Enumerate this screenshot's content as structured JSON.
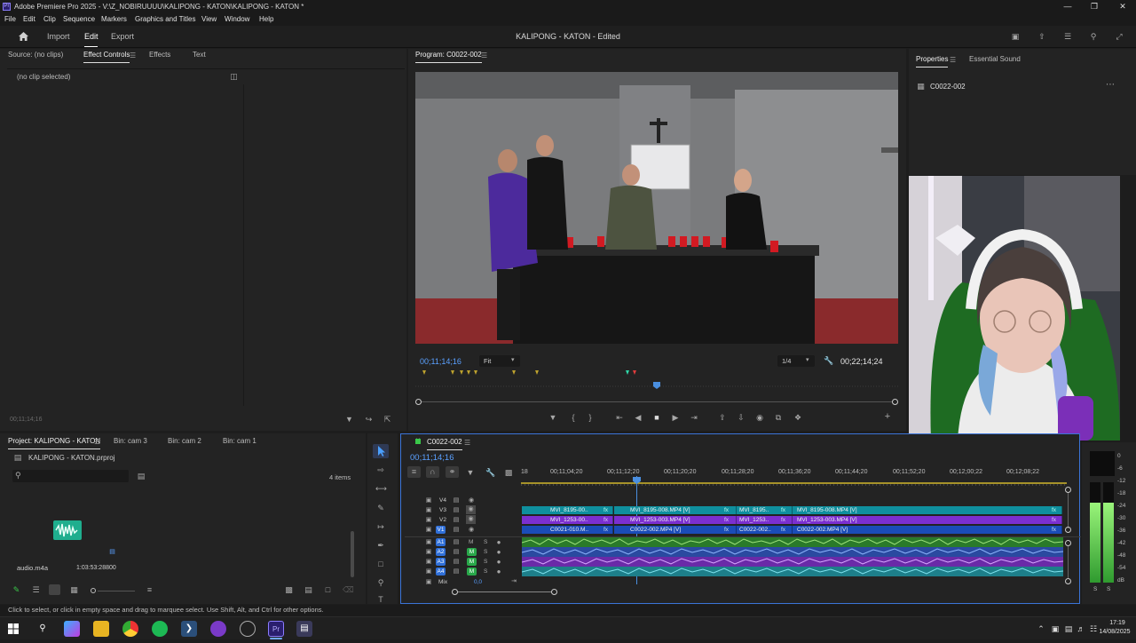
{
  "titlebar": {
    "title": "Adobe Premiere Pro 2025 - V:\\Z_NOBIRUUUU\\KALIPONG - KATON\\KALIPONG - KATON *",
    "logo": "Pr"
  },
  "menu": [
    "File",
    "Edit",
    "Clip",
    "Sequence",
    "Markers",
    "Graphics and Titles",
    "View",
    "Window",
    "Help"
  ],
  "workspace": {
    "tabs": [
      "Import",
      "Edit",
      "Export"
    ],
    "active": "Edit",
    "doc_title": "KALIPONG - KATON - Edited"
  },
  "source_panel": {
    "tabs": [
      "Source: (no clips)",
      "Effect Controls",
      "Effects",
      "Text"
    ],
    "active": "Effect Controls",
    "empty_msg": "(no clip selected)",
    "timecode": "00;11;14;16"
  },
  "program": {
    "title": "Program: C0022-002",
    "timecode": "00;11;14;16",
    "fit": "Fit",
    "quality": "1/4",
    "duration": "00;22;14;24"
  },
  "properties": {
    "tabs": [
      "Properties",
      "Essential Sound"
    ],
    "active": "Properties",
    "item": "C0022-002"
  },
  "project": {
    "tabs": [
      "Project: KALIPONG - KATON",
      "Bin: cam 3",
      "Bin: cam 2",
      "Bin: cam 1"
    ],
    "active": "Project: KALIPONG - KATON",
    "file": "KALIPONG - KATON.prproj",
    "items_count": "4 items",
    "asset_name": "audio.m4a",
    "asset_duration": "1:03:53:28800"
  },
  "timeline": {
    "title": "C0022-002",
    "timecode": "00;11;14;16",
    "ruler": [
      "18",
      "00;11;04;20",
      "00;11;12;20",
      "00;11;20;20",
      "00;11;28;20",
      "00;11;36;20",
      "00;11;44;20",
      "00;11;52;20",
      "00;12;00;22",
      "00;12;08;22"
    ],
    "video_tracks": [
      "V4",
      "V3",
      "V2",
      "V1"
    ],
    "audio_tracks": [
      "A1",
      "A2",
      "A3",
      "A4"
    ],
    "mix_label": "Mix",
    "mix_value": "0,0",
    "clips_v3": [
      "MVI_8195-00..",
      "MVI_8195-008.MP4 [V]",
      "MVI_8195..",
      "MVI_8195-008.MP4 [V]"
    ],
    "clips_v2": [
      "MVI_1253-00..",
      "MVI_1253-003.MP4 [V]",
      "MVI_1253..",
      "MVI_1253-003.MP4 [V]"
    ],
    "clips_v1": [
      "C0021-010.M..",
      "C0022-002.MP4 [V]",
      "C0022-002..",
      "C0022-002.MP4 [V]"
    ],
    "fx_mark": "fx"
  },
  "meter": {
    "labels": [
      "0",
      "-6",
      "-12",
      "-18",
      "-24",
      "-30",
      "-36",
      "-42",
      "-48",
      "-54",
      "dB"
    ],
    "solo": [
      "S",
      "S"
    ],
    "level_left": 0.8,
    "level_right": 0.8
  },
  "status": "Click to select, or click in empty space and drag to marquee select. Use Shift, Alt, and Ctrl for other options.",
  "clock": {
    "time": "17:19",
    "date": "14/08/2025"
  },
  "colors": {
    "accent_blue": "#2f7bf5",
    "timecode_blue": "#5aa0ff",
    "clip_teal": "#0f8f9e",
    "clip_purple": "#7b2fd0",
    "clip_blue": "#1a4cb8",
    "audio_green": "#3aa53a",
    "meter_green": "#4cc04c"
  }
}
